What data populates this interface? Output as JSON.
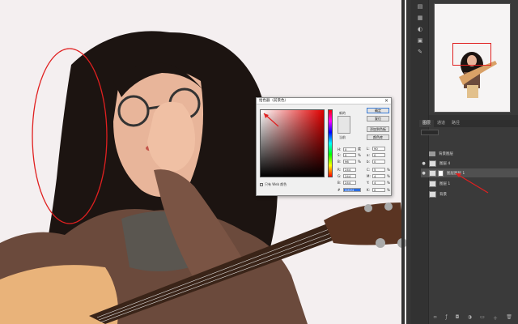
{
  "picker": {
    "title": "拾色器（前景色）",
    "ok": "确定",
    "reset": "复位",
    "add_swatch": "添加到色板",
    "libraries": "颜色库",
    "new_label": "新的",
    "current_label": "当前",
    "web_only": "只有 Web 颜色",
    "fields": [
      {
        "label": "H:",
        "value": "0",
        "unit": "度",
        "label2": "L:",
        "value2": "90"
      },
      {
        "label": "S:",
        "value": "0",
        "unit": "%",
        "label2": "a:",
        "value2": "0"
      },
      {
        "label": "B:",
        "value": "96",
        "unit": "%",
        "label2": "b:",
        "value2": "0"
      },
      {
        "label": "R:",
        "value": "244",
        "unit": "",
        "label2": "C:",
        "value2": "5",
        "unit2": "%"
      },
      {
        "label": "G:",
        "value": "244",
        "unit": "",
        "label2": "M:",
        "value2": "4",
        "unit2": "%"
      },
      {
        "label": "B:",
        "value": "244",
        "unit": "",
        "label2": "Y:",
        "value2": "4",
        "unit2": "%"
      }
    ],
    "k_field": {
      "label": "K:",
      "value": "0",
      "unit": "%"
    },
    "hex_label": "#",
    "hex_value": "f4f4f4"
  },
  "panel_tabs": [
    "图层",
    "通道",
    "路径"
  ],
  "layers": [
    {
      "name": "背景图层",
      "type": "group",
      "selected": false
    },
    {
      "name": "图层 4",
      "type": "layer",
      "selected": false
    },
    {
      "name": "图层图层 1",
      "type": "mask",
      "selected": true
    },
    {
      "name": "图层 1",
      "type": "layer",
      "selected": false
    },
    {
      "name": "背景",
      "type": "layer",
      "selected": false
    }
  ],
  "accent": "#e02020"
}
